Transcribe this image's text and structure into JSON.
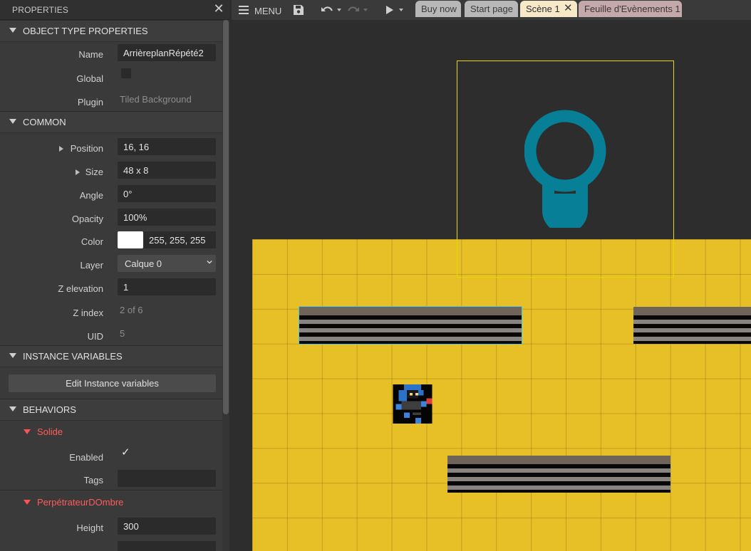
{
  "properties_panel": {
    "title": "PROPERTIES",
    "sections": {
      "object_type": "OBJECT TYPE PROPERTIES",
      "common": "COMMON",
      "instance_variables": "INSTANCE VARIABLES",
      "behaviors": "BEHAVIORS"
    },
    "object_type": {
      "name_label": "Name",
      "name_value": "ArrièreplanRépété2",
      "global_label": "Global",
      "global_checked": false,
      "plugin_label": "Plugin",
      "plugin_value": "Tiled Background"
    },
    "common": {
      "position_label": "Position",
      "position_value": "16, 16",
      "size_label": "Size",
      "size_value": "48 x 8",
      "angle_label": "Angle",
      "angle_value": "0°",
      "opacity_label": "Opacity",
      "opacity_value": "100%",
      "color_label": "Color",
      "color_value": "255, 255, 255",
      "color_swatch": "#ffffff",
      "layer_label": "Layer",
      "layer_value": "Calque 0",
      "z_elevation_label": "Z elevation",
      "z_elevation_value": "1",
      "z_index_label": "Z index",
      "z_index_value": "2 of 6",
      "uid_label": "UID",
      "uid_value": "5"
    },
    "instance_variables": {
      "edit_button": "Edit Instance variables"
    },
    "behaviors": {
      "solid": {
        "name": "Solide",
        "enabled_label": "Enabled",
        "enabled_checked": true,
        "tags_label": "Tags",
        "tags_value": ""
      },
      "shadow": {
        "name": "PerpétrateurDOmbre",
        "height_label": "Height",
        "height_value": "300"
      }
    }
  },
  "toolbar": {
    "menu_label": "MENU",
    "icons": [
      "menu-icon",
      "save-icon",
      "undo-icon",
      "redo-icon",
      "play-icon"
    ],
    "tabs": [
      {
        "label": "Buy now"
      },
      {
        "label": "Start page"
      },
      {
        "label": "Scène 1",
        "active": true
      },
      {
        "label": "Feuille d'Evènements 1"
      }
    ]
  },
  "colors": {
    "layout_background": "#e7bf27",
    "bulb": "#067f97",
    "selection": "#e6d800",
    "behavior_name": "#ff5b5b"
  }
}
